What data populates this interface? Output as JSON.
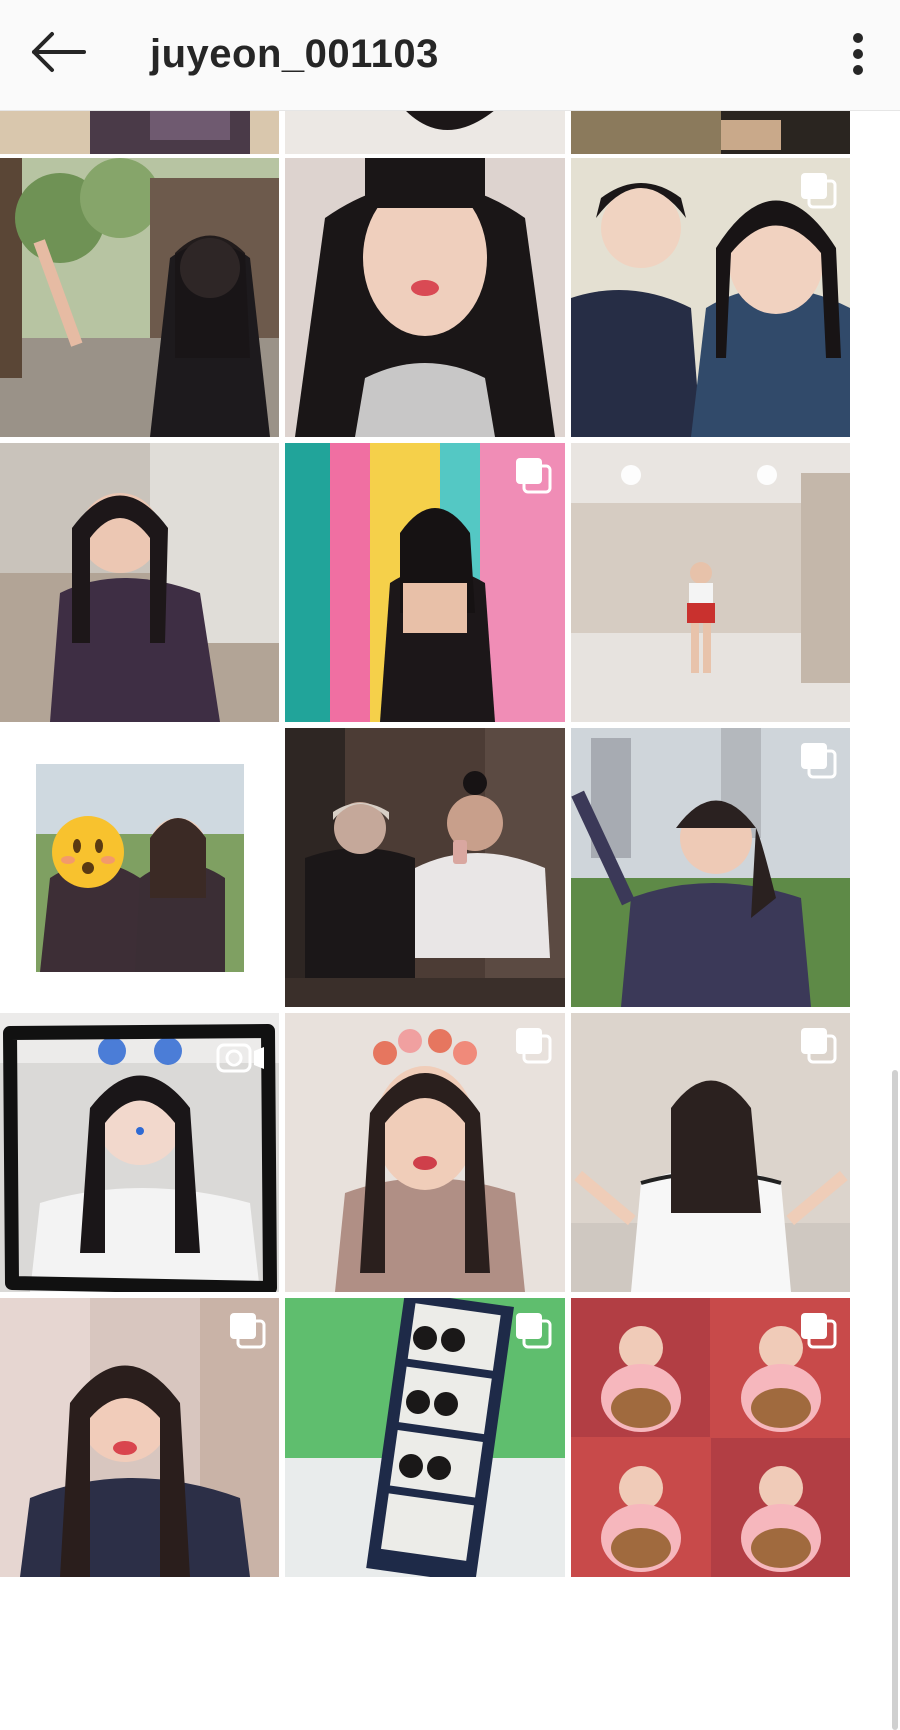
{
  "header": {
    "title": "juyeon_001103",
    "back_icon": "arrow-left-icon",
    "more_icon": "more-vertical-icon"
  },
  "grid": {
    "rows_visible": 6,
    "columns": 3,
    "multi_photo_icon": "multiple-photos-icon"
  },
  "colors": {
    "header_bg": "#fafafa",
    "title_text": "#262626",
    "divider": "#e6e6e6"
  }
}
